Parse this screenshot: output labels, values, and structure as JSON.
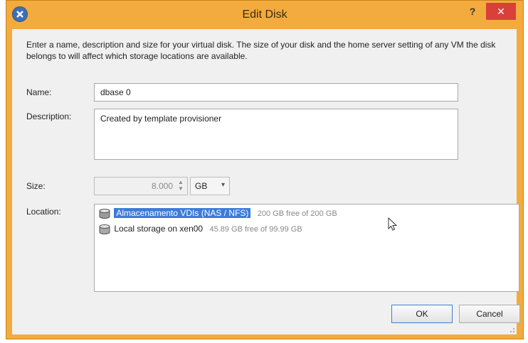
{
  "window": {
    "title": "Edit Disk",
    "help_glyph": "?",
    "close_glyph": "✕"
  },
  "intro_text": "Enter a name, description and size for your virtual disk. The size of your disk and the home server setting of any VM the disk belongs to will affect which storage locations are available.",
  "form": {
    "name_label": "Name:",
    "name_value": "dbase 0",
    "description_label": "Description:",
    "description_value": "Created by template provisioner",
    "size_label": "Size:",
    "size_value": "8.000",
    "size_unit": "GB",
    "location_label": "Location:"
  },
  "locations": [
    {
      "name": "Almacenamento VDIs (NAS / NFS)",
      "detail": "200 GB free of 200 GB",
      "selected": true,
      "icon": "storage-disk-icon"
    },
    {
      "name": "Local storage on xen00",
      "detail": "45.89 GB free of 99.99 GB",
      "selected": false,
      "icon": "storage-disk-icon"
    }
  ],
  "buttons": {
    "ok": "OK",
    "cancel": "Cancel"
  },
  "colors": {
    "window_frame": "#f3ab3d",
    "close_button": "#d9403a",
    "selection": "#3d7bd9"
  }
}
